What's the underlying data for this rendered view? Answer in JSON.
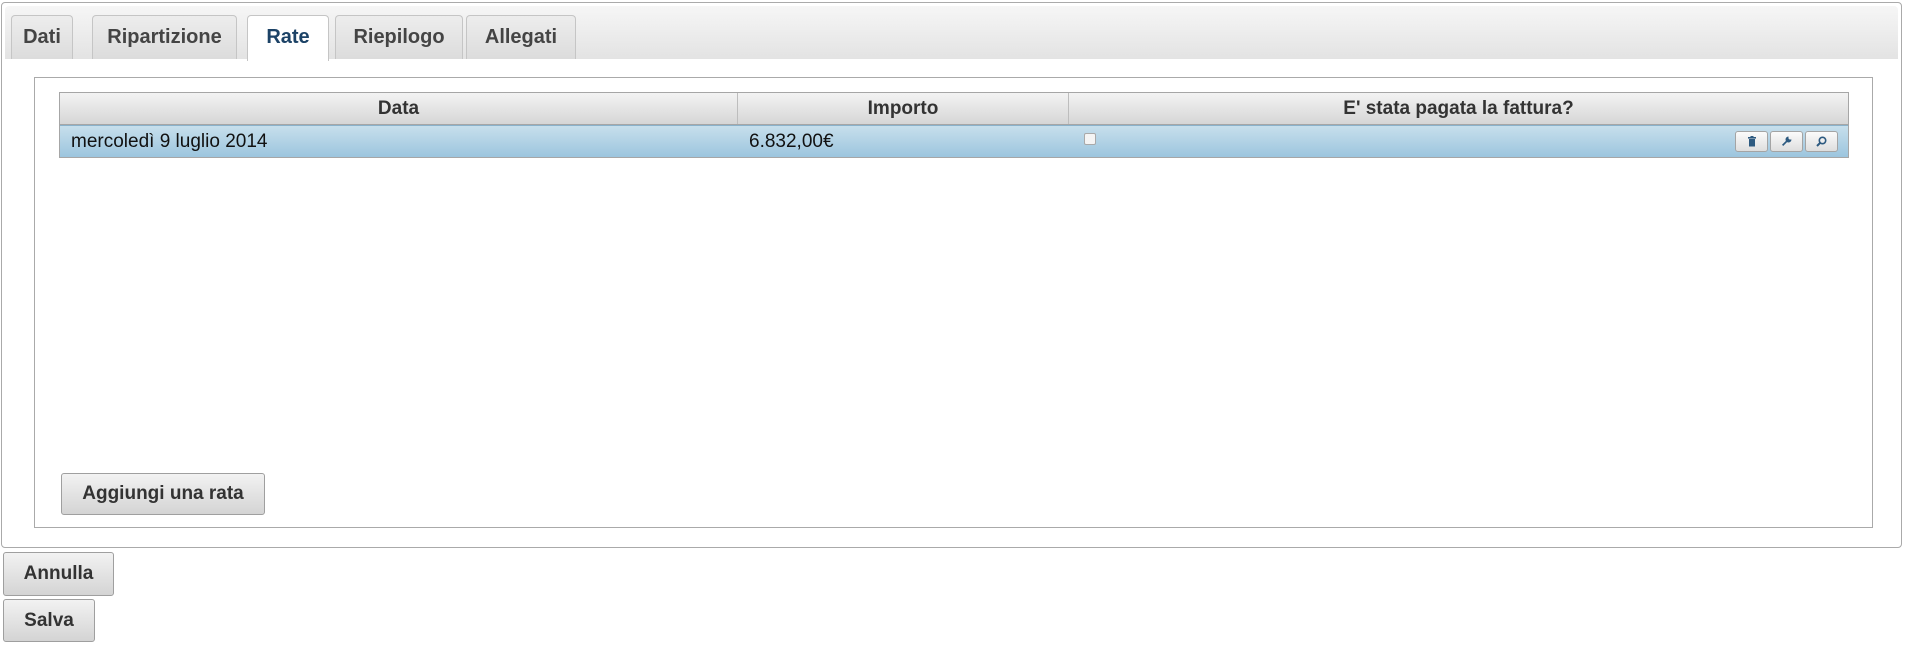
{
  "tabs": [
    {
      "label": "Dati",
      "active": false
    },
    {
      "label": "Ripartizione",
      "active": false
    },
    {
      "label": "Rate",
      "active": true
    },
    {
      "label": "Riepilogo",
      "active": false
    },
    {
      "label": "Allegati",
      "active": false
    }
  ],
  "grid": {
    "columns": [
      "Data",
      "Importo",
      "E' stata pagata la fattura?"
    ],
    "rows": [
      {
        "data": "mercoledì 9 luglio 2014",
        "importo": "6.832,00€",
        "pagata": false
      }
    ],
    "row_actions": [
      "trash-icon",
      "wrench-icon",
      "magnifier-icon"
    ]
  },
  "buttons": {
    "add_rate": "Aggiungi una rata",
    "annulla": "Annulla",
    "salva": "Salva"
  },
  "colors": {
    "active_tab_text": "#1c4266",
    "selected_row": "#9cc5de"
  }
}
